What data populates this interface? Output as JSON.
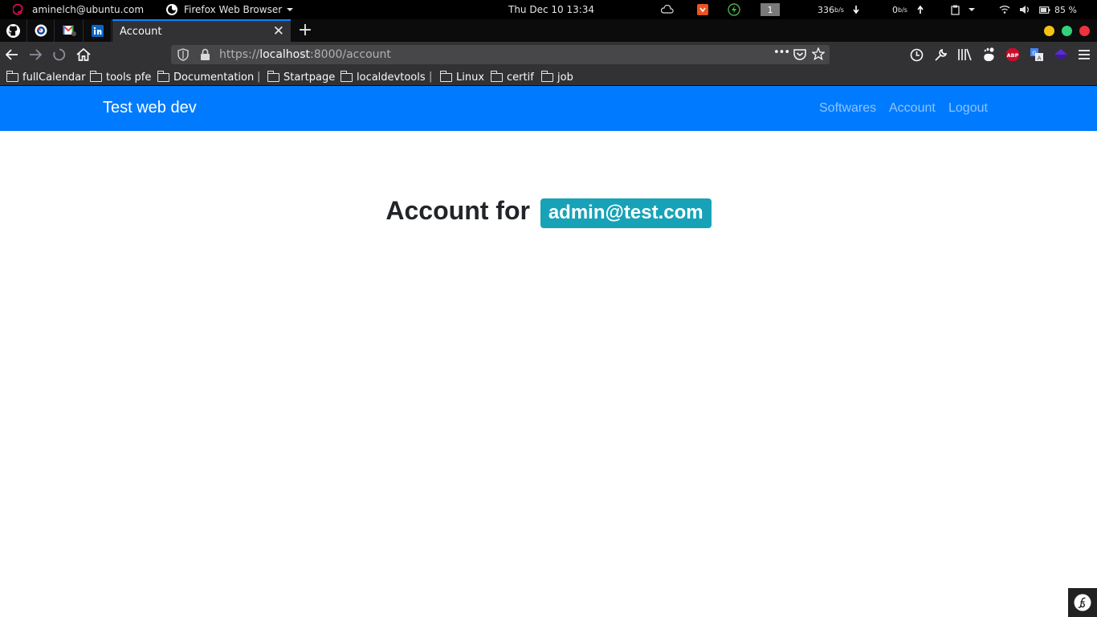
{
  "os_bar": {
    "user": "aminelch@ubuntu.com",
    "app_menu": "Firefox Web Browser",
    "datetime": "Thu Dec 10  13:34",
    "workspace": "1",
    "net_down": "336",
    "net_down_unit": "b/s",
    "net_up": "0",
    "net_up_unit": "b/s",
    "battery": "85 %",
    "icons": [
      "debian-icon",
      "firefox-icon",
      "cloud-icon",
      "package-icon",
      "power-icon",
      "clipboard-icon",
      "wifi-icon",
      "volume-icon",
      "battery-icon"
    ]
  },
  "tabs": {
    "pinned": [
      "github-icon",
      "sync-icon",
      "gmail-icon",
      "linkedin-icon"
    ],
    "active_title": "Account",
    "close_label": "✕",
    "new_tab_label": "+"
  },
  "nav": {
    "url_scheme": "https://",
    "url_host": "localhost",
    "url_path": ":8000/account",
    "more_label": "•••"
  },
  "bookmarks": [
    {
      "label": "fullCalendar"
    },
    {
      "label": "tools pfe"
    },
    {
      "label": "Documentation"
    },
    {
      "label": "Startpage"
    },
    {
      "label": "localdevtools"
    },
    {
      "label": "Linux"
    },
    {
      "label": "certif"
    },
    {
      "label": "job"
    }
  ],
  "page": {
    "brand": "Test web dev",
    "links": [
      "Softwares",
      "Account",
      "Logout"
    ],
    "heading_prefix": "Account for",
    "email": "admin@test.com"
  },
  "colors": {
    "navbar": "#007bff",
    "badge": "#17a2b8",
    "active_tab_line": "#0a84ff"
  }
}
